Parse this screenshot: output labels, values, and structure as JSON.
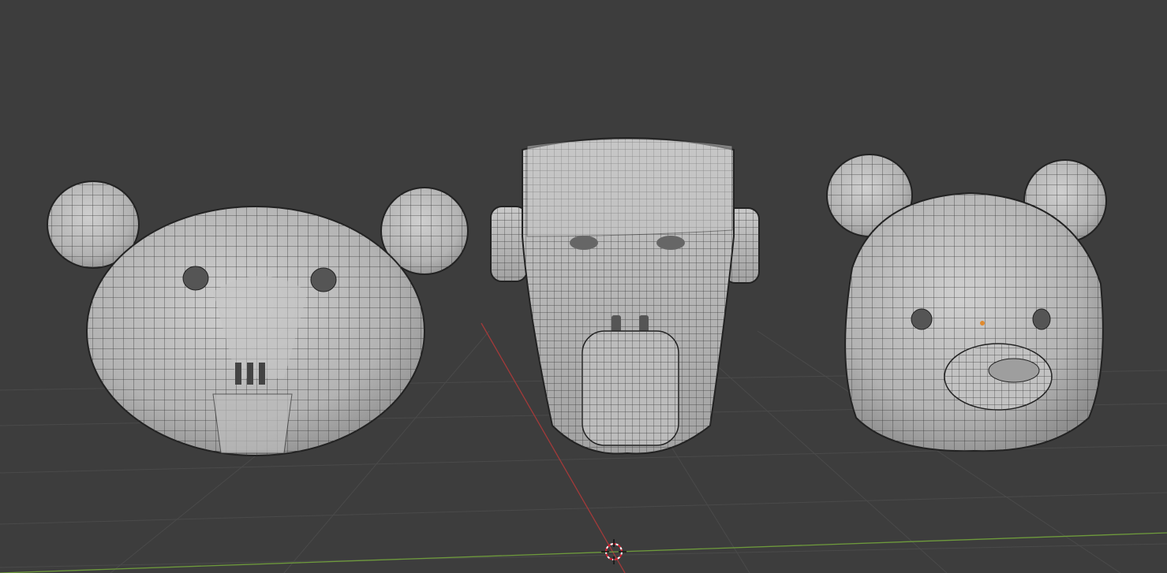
{
  "viewport": {
    "background": "#3d3d3d",
    "grid_color": "#4a4a4a",
    "x_axis_color": "#a33a3a",
    "y_axis_color": "#6e9a3c",
    "mesh_fill": "#b8b8b8",
    "wire_color": "#2a2a2a"
  },
  "objects": [
    {
      "name": "rodent-head-mesh",
      "icon": "mesh-object"
    },
    {
      "name": "monkey-head-mesh",
      "icon": "mesh-object"
    },
    {
      "name": "bear-head-mesh",
      "icon": "mesh-object"
    }
  ],
  "cursor": {
    "icon": "3d-cursor-icon"
  }
}
